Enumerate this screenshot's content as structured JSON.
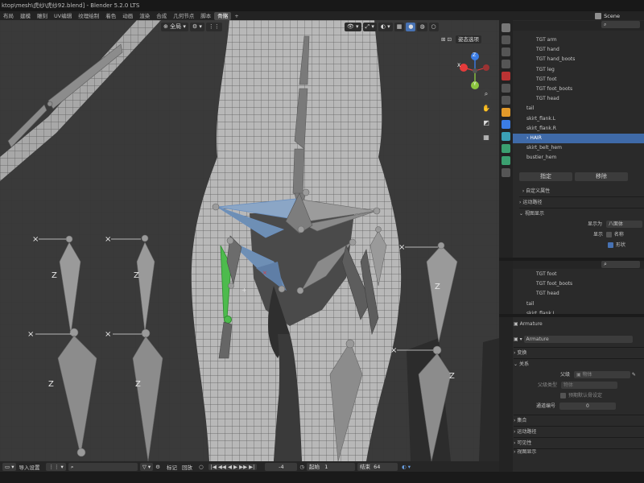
{
  "window": {
    "title": "ktop\\mesh\\虎纱\\虎纱92.blend] - Blender 5.2.0 LTS"
  },
  "workspace_tabs": [
    {
      "label": "布局",
      "active": false
    },
    {
      "label": "建模",
      "active": false
    },
    {
      "label": "雕刻",
      "active": false
    },
    {
      "label": "UV编辑",
      "active": false
    },
    {
      "label": "纹理绘制",
      "active": false
    },
    {
      "label": "着色",
      "active": false
    },
    {
      "label": "动画",
      "active": false
    },
    {
      "label": "渲染",
      "active": false
    },
    {
      "label": "合成",
      "active": false
    },
    {
      "label": "几何节点",
      "active": false
    },
    {
      "label": "脚本",
      "active": false
    },
    {
      "label": "骨骼",
      "active": true
    }
  ],
  "add_tab_label": "+",
  "scene_label": "Scene",
  "viewport": {
    "transform_orientation": "全局",
    "gizmo_labels": {
      "x": "X",
      "y": "Y",
      "z": "Z"
    },
    "overlay_label": "姿态选项"
  },
  "outliner": {
    "items": [
      {
        "label": "TGT arm",
        "indent": 2,
        "selected": false
      },
      {
        "label": "TGT hand",
        "indent": 2,
        "selected": false
      },
      {
        "label": "TGT hand_boots",
        "indent": 2,
        "selected": false
      },
      {
        "label": "TGT leg",
        "indent": 2,
        "selected": false
      },
      {
        "label": "TGT  foot",
        "indent": 2,
        "selected": false
      },
      {
        "label": "TGT foot_boots",
        "indent": 2,
        "selected": false
      },
      {
        "label": "TGT head",
        "indent": 2,
        "selected": false
      },
      {
        "label": "tail",
        "indent": 1,
        "selected": false
      },
      {
        "label": "skirt_flank.L",
        "indent": 1,
        "selected": false
      },
      {
        "label": "skirt_flank.R",
        "indent": 1,
        "selected": false
      },
      {
        "label": "HAIR",
        "indent": 1,
        "selected": true
      },
      {
        "label": "skirt_belt_hem",
        "indent": 1,
        "selected": false
      },
      {
        "label": "bustier_hem",
        "indent": 1,
        "selected": false
      }
    ],
    "assign_button": "指定",
    "remove_button": "移除",
    "custom_props": "自定义属性",
    "motion_paths": "运动路径",
    "viewport_display": "视图显示",
    "display_as_label": "显示为",
    "display_as_value": "八面体",
    "show_label": "显示",
    "show_names": "名称",
    "show_shapes": "形状"
  },
  "outliner2": {
    "items": [
      {
        "label": "TGT foot",
        "indent": 2
      },
      {
        "label": "TGT foot_boots",
        "indent": 2
      },
      {
        "label": "TGT head",
        "indent": 2
      },
      {
        "label": "tail",
        "indent": 1
      },
      {
        "label": "skirt_flank.L",
        "indent": 1
      }
    ]
  },
  "properties": {
    "object_name": "Armature",
    "data_name": "Armature",
    "sections": {
      "transform": "变换",
      "relations": "关系",
      "collections": "集合",
      "motion_paths": "运动路径",
      "visibility": "可见性",
      "viewport_display": "视图显示"
    },
    "parent_label": "父级",
    "parent_value": "物体",
    "parent_type_label": "父级类型",
    "parent_type_value": "物体",
    "keep_transform": "预期默认骨设定",
    "pass_index_label": "通道编号",
    "pass_index_value": "0"
  },
  "timeline": {
    "keying_label": "导入设置",
    "search_placeholder": "",
    "marker_label": "标记",
    "playback_label": "回放",
    "current_frame": "-4",
    "start_label": "起始",
    "start_value": "1",
    "end_label": "结束",
    "end_value": "64"
  },
  "colors": {
    "selection": "#3f6aa8",
    "bone_selected": "#4dbb4d",
    "bone_active": "#6a8fbf",
    "gizmo_x": "#e53b3b",
    "gizmo_y": "#8cc63f",
    "gizmo_z": "#3b7de5"
  }
}
